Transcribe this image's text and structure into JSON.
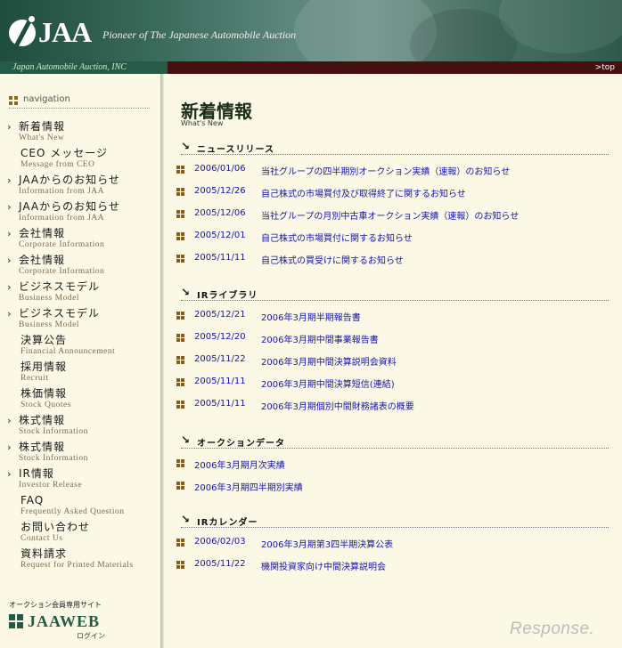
{
  "header": {
    "logo_text": "JAA",
    "tagline": "Pioneer of The Japanese Automobile Auction",
    "company": "Japan Automobile Auction, INC",
    "top_link": ">top"
  },
  "sidebar": {
    "heading": "navigation",
    "items": [
      {
        "jp": "新着情報",
        "en": "What's New",
        "arrow": true
      },
      {
        "jp": "CEO メッセージ",
        "en": "Message from CEO",
        "arrow": false
      },
      {
        "jp": "JAAからのお知らせ",
        "en": "Information from JAA",
        "arrow": true
      },
      {
        "jp": "JAAからのお知らせ",
        "en": "Information from JAA",
        "arrow": true
      },
      {
        "jp": "会社情報",
        "en": "Corporate Information",
        "arrow": true
      },
      {
        "jp": "会社情報",
        "en": "Corporate Information",
        "arrow": true
      },
      {
        "jp": "ビジネスモデル",
        "en": "Business Model",
        "arrow": true
      },
      {
        "jp": "ビジネスモデル",
        "en": "Business Model",
        "arrow": true
      },
      {
        "jp": "決算公告",
        "en": "Financial Announcement",
        "arrow": false
      },
      {
        "jp": "採用情報",
        "en": "Recruit",
        "arrow": false
      },
      {
        "jp": "株価情報",
        "en": "Stock Quotes",
        "arrow": false
      },
      {
        "jp": "株式情報",
        "en": "Stock Information",
        "arrow": true
      },
      {
        "jp": "株式情報",
        "en": "Stock Information",
        "arrow": true
      },
      {
        "jp": "IR情報",
        "en": "Investor Release",
        "arrow": true
      },
      {
        "jp": "FAQ",
        "en": "Frequently Asked Question",
        "arrow": false
      },
      {
        "jp": "お問い合わせ",
        "en": "Contact Us",
        "arrow": false
      },
      {
        "jp": "資料請求",
        "en": "Request for Printed Materials",
        "arrow": false
      }
    ],
    "auction_label": "オークション会員専用サイト",
    "jaaweb": "JAAWEB",
    "login": "ログイン"
  },
  "main": {
    "title": "新着情報",
    "subtitle": "What's New",
    "sections": [
      {
        "title": "ニュースリリース",
        "items": [
          {
            "date": "2006/01/06",
            "text": "当社グループの四半期別オークション実績（速報）のお知らせ"
          },
          {
            "date": "2005/12/26",
            "text": "自己株式の市場買付及び取得終了に関するお知らせ"
          },
          {
            "date": "2005/12/06",
            "text": "当社グループの月別中古車オークション実績（速報）のお知らせ"
          },
          {
            "date": "2005/12/01",
            "text": "自己株式の市場買付に関するお知らせ"
          },
          {
            "date": "2005/11/11",
            "text": "自己株式の買受けに関するお知らせ"
          }
        ]
      },
      {
        "title": "IRライブラリ",
        "items": [
          {
            "date": "2005/12/21",
            "text": "2006年3月期半期報告書"
          },
          {
            "date": "2005/12/20",
            "text": "2006年3月期中間事業報告書"
          },
          {
            "date": "2005/11/22",
            "text": "2006年3月期中間決算説明会資料"
          },
          {
            "date": "2005/11/11",
            "text": "2006年3月期中間決算短信(連結)"
          },
          {
            "date": "2005/11/11",
            "text": "2006年3月期個別中間財務諸表の概要"
          }
        ]
      },
      {
        "title": "オークションデータ",
        "items": [
          {
            "date": "",
            "text": "2006年3月期月次実績"
          },
          {
            "date": "",
            "text": "2006年3月期四半期別実績"
          }
        ]
      },
      {
        "title": "IRカレンダー",
        "items": [
          {
            "date": "2006/02/03",
            "text": "2006年3月期第3四半期決算公表"
          },
          {
            "date": "2005/11/22",
            "text": "機関投資家向け中間決算説明会"
          }
        ]
      }
    ]
  },
  "watermark": "Response."
}
